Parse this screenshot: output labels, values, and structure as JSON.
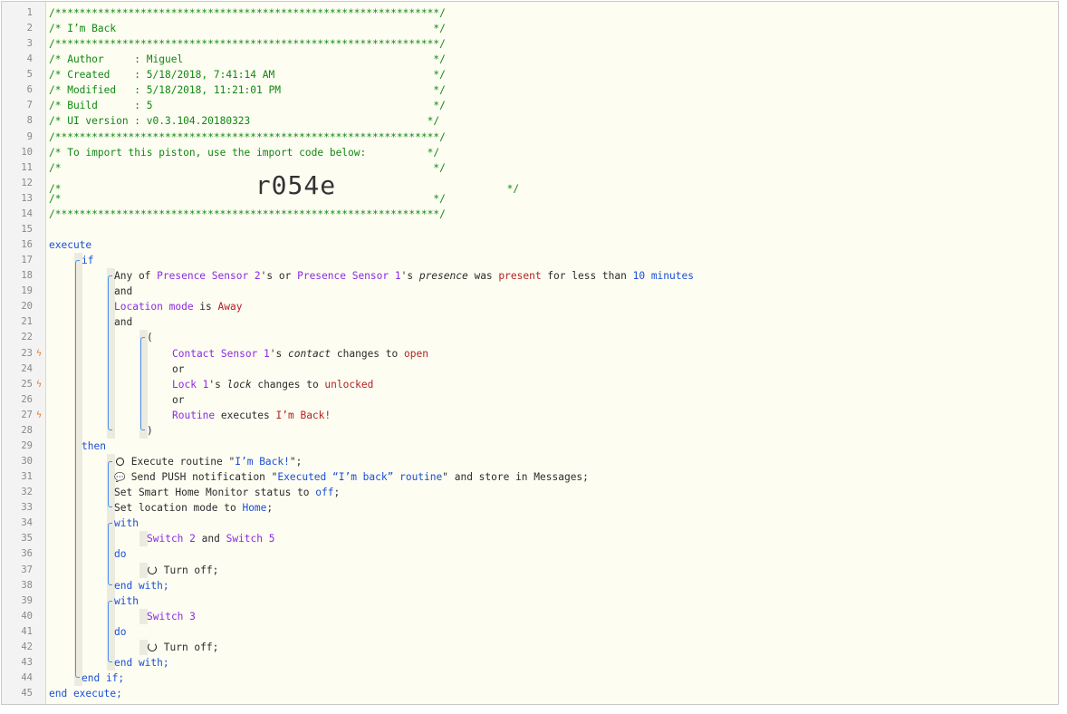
{
  "colors": {
    "comment": "#118811",
    "keyword": "#1a4fd6",
    "device": "#8a2be2",
    "value": "#b22222",
    "number": "#1a4fd6",
    "text": "#2b2b2b",
    "bolt": "#f07a1f",
    "guide": "#ecebdf",
    "bracket": "#4d8ff0"
  },
  "icons": {
    "bolt": "lightning-bolt-icon",
    "clock": "clock-icon",
    "speech": "speech-bubble-icon",
    "power": "power-icon"
  },
  "lines": [
    {
      "n": "1",
      "indent": 0,
      "tokens": [
        {
          "t": "/***************************************************************/",
          "c": "comment"
        }
      ]
    },
    {
      "n": "2",
      "indent": 0,
      "tokens": [
        {
          "t": "/* I’m Back                                                    */",
          "c": "comment"
        }
      ]
    },
    {
      "n": "3",
      "indent": 0,
      "tokens": [
        {
          "t": "/***************************************************************/",
          "c": "comment"
        }
      ]
    },
    {
      "n": "4",
      "indent": 0,
      "tokens": [
        {
          "t": "/* Author     : Miguel                                         */",
          "c": "comment"
        }
      ]
    },
    {
      "n": "5",
      "indent": 0,
      "tokens": [
        {
          "t": "/* Created    : 5/18/2018, 7:41:14 AM                          */",
          "c": "comment"
        }
      ]
    },
    {
      "n": "6",
      "indent": 0,
      "tokens": [
        {
          "t": "/* Modified   : 5/18/2018, 11:21:01 PM                         */",
          "c": "comment"
        }
      ]
    },
    {
      "n": "7",
      "indent": 0,
      "tokens": [
        {
          "t": "/* Build      : 5                                              */",
          "c": "comment"
        }
      ]
    },
    {
      "n": "8",
      "indent": 0,
      "tokens": [
        {
          "t": "/* UI version : v0.3.104.20180323                             */",
          "c": "comment"
        }
      ]
    },
    {
      "n": "9",
      "indent": 0,
      "tokens": [
        {
          "t": "/***************************************************************/",
          "c": "comment"
        }
      ]
    },
    {
      "n": "10",
      "indent": 0,
      "tokens": [
        {
          "t": "/* To import this piston, use the import code below:          */",
          "c": "comment"
        }
      ]
    },
    {
      "n": "11",
      "indent": 0,
      "tokens": [
        {
          "t": "/*                                                             */",
          "c": "comment"
        }
      ]
    },
    {
      "n": "12",
      "indent": 0,
      "tokens": [
        {
          "t": "/*",
          "c": "comment"
        },
        {
          "t": "            r054e",
          "c": "big"
        },
        {
          "t": "                            */",
          "c": "comment"
        }
      ]
    },
    {
      "n": "13",
      "indent": 0,
      "tokens": [
        {
          "t": "/*                                                             */",
          "c": "comment"
        }
      ]
    },
    {
      "n": "14",
      "indent": 0,
      "tokens": [
        {
          "t": "/***************************************************************/",
          "c": "comment"
        }
      ]
    },
    {
      "n": "15",
      "indent": 0,
      "tokens": []
    },
    {
      "n": "16",
      "indent": 0,
      "tokens": [
        {
          "t": "execute",
          "c": "keyword"
        }
      ]
    },
    {
      "n": "17",
      "indent": 1,
      "tokens": [
        {
          "t": "if",
          "c": "keyword"
        }
      ]
    },
    {
      "n": "18",
      "indent": 2,
      "tokens": [
        {
          "t": "Any of ",
          "c": "text"
        },
        {
          "t": "Presence Sensor 2",
          "c": "device"
        },
        {
          "t": "'s or ",
          "c": "text"
        },
        {
          "t": "Presence Sensor 1",
          "c": "device"
        },
        {
          "t": "'s ",
          "c": "text"
        },
        {
          "t": "presence",
          "c": "italic"
        },
        {
          "t": " was ",
          "c": "text"
        },
        {
          "t": "present",
          "c": "value"
        },
        {
          "t": " for less than ",
          "c": "text"
        },
        {
          "t": "10 minutes",
          "c": "number"
        }
      ]
    },
    {
      "n": "19",
      "indent": 2,
      "tokens": [
        {
          "t": "and",
          "c": "text"
        }
      ]
    },
    {
      "n": "20",
      "indent": 2,
      "tokens": [
        {
          "t": "Location mode",
          "c": "device"
        },
        {
          "t": " is ",
          "c": "text"
        },
        {
          "t": "Away",
          "c": "value"
        }
      ]
    },
    {
      "n": "21",
      "indent": 2,
      "tokens": [
        {
          "t": "and",
          "c": "text"
        }
      ]
    },
    {
      "n": "22",
      "indent": 3,
      "tokens": [
        {
          "t": "(",
          "c": "text"
        }
      ]
    },
    {
      "n": "23",
      "indent": 4,
      "bolt": true,
      "tokens": [
        {
          "t": "Contact Sensor 1",
          "c": "device"
        },
        {
          "t": "'s ",
          "c": "text"
        },
        {
          "t": "contact",
          "c": "italic"
        },
        {
          "t": " changes to ",
          "c": "text"
        },
        {
          "t": "open",
          "c": "value"
        }
      ]
    },
    {
      "n": "24",
      "indent": 4,
      "tokens": [
        {
          "t": "or",
          "c": "text"
        }
      ]
    },
    {
      "n": "25",
      "indent": 4,
      "bolt": true,
      "tokens": [
        {
          "t": "Lock 1",
          "c": "device"
        },
        {
          "t": "'s ",
          "c": "text"
        },
        {
          "t": "lock",
          "c": "italic"
        },
        {
          "t": " changes to ",
          "c": "text"
        },
        {
          "t": "unlocked",
          "c": "value"
        }
      ]
    },
    {
      "n": "26",
      "indent": 4,
      "tokens": [
        {
          "t": "or",
          "c": "text"
        }
      ]
    },
    {
      "n": "27",
      "indent": 4,
      "bolt": true,
      "tokens": [
        {
          "t": "Routine",
          "c": "device"
        },
        {
          "t": " executes ",
          "c": "text"
        },
        {
          "t": "I’m Back!",
          "c": "value"
        }
      ]
    },
    {
      "n": "28",
      "indent": 3,
      "tokens": [
        {
          "t": ")",
          "c": "text"
        }
      ]
    },
    {
      "n": "29",
      "indent": 1,
      "tokens": [
        {
          "t": "then",
          "c": "keyword"
        }
      ]
    },
    {
      "n": "30",
      "indent": 2,
      "tokens": [
        {
          "t": "",
          "c": "icon-clock"
        },
        {
          "t": " Execute routine \"",
          "c": "text"
        },
        {
          "t": "I’m Back!",
          "c": "keyword"
        },
        {
          "t": "\";",
          "c": "text"
        }
      ]
    },
    {
      "n": "31",
      "indent": 2,
      "tokens": [
        {
          "t": "💬",
          "c": "icon-speech"
        },
        {
          "t": " Send PUSH notification \"",
          "c": "text"
        },
        {
          "t": "Executed “I’m back” routine",
          "c": "keyword"
        },
        {
          "t": "\" and store in Messages;",
          "c": "text"
        }
      ]
    },
    {
      "n": "32",
      "indent": 2,
      "tokens": [
        {
          "t": "Set Smart Home Monitor status to ",
          "c": "text"
        },
        {
          "t": "off",
          "c": "keyword"
        },
        {
          "t": ";",
          "c": "text"
        }
      ]
    },
    {
      "n": "33",
      "indent": 2,
      "tokens": [
        {
          "t": "Set location mode to ",
          "c": "text"
        },
        {
          "t": "Home",
          "c": "keyword"
        },
        {
          "t": ";",
          "c": "text"
        }
      ]
    },
    {
      "n": "34",
      "indent": 2,
      "tokens": [
        {
          "t": "with",
          "c": "keyword"
        }
      ]
    },
    {
      "n": "35",
      "indent": 3,
      "tokens": [
        {
          "t": "Switch 2",
          "c": "device"
        },
        {
          "t": " and ",
          "c": "text"
        },
        {
          "t": "Switch 5",
          "c": "device"
        }
      ]
    },
    {
      "n": "36",
      "indent": 2,
      "tokens": [
        {
          "t": "do",
          "c": "keyword"
        }
      ]
    },
    {
      "n": "37",
      "indent": 3,
      "tokens": [
        {
          "t": "",
          "c": "icon-power"
        },
        {
          "t": " Turn off;",
          "c": "text"
        }
      ]
    },
    {
      "n": "38",
      "indent": 2,
      "tokens": [
        {
          "t": "end with;",
          "c": "keyword"
        }
      ]
    },
    {
      "n": "39",
      "indent": 2,
      "tokens": [
        {
          "t": "with",
          "c": "keyword"
        }
      ]
    },
    {
      "n": "40",
      "indent": 3,
      "tokens": [
        {
          "t": "Switch 3",
          "c": "device"
        }
      ]
    },
    {
      "n": "41",
      "indent": 2,
      "tokens": [
        {
          "t": "do",
          "c": "keyword"
        }
      ]
    },
    {
      "n": "42",
      "indent": 3,
      "tokens": [
        {
          "t": "",
          "c": "icon-power"
        },
        {
          "t": " Turn off;",
          "c": "text"
        }
      ]
    },
    {
      "n": "43",
      "indent": 2,
      "tokens": [
        {
          "t": "end with;",
          "c": "keyword"
        }
      ]
    },
    {
      "n": "44",
      "indent": 1,
      "tokens": [
        {
          "t": "end if;",
          "c": "keyword"
        }
      ]
    },
    {
      "n": "45",
      "indent": 0,
      "tokens": [
        {
          "t": "end execute;",
          "c": "keyword"
        }
      ]
    }
  ]
}
